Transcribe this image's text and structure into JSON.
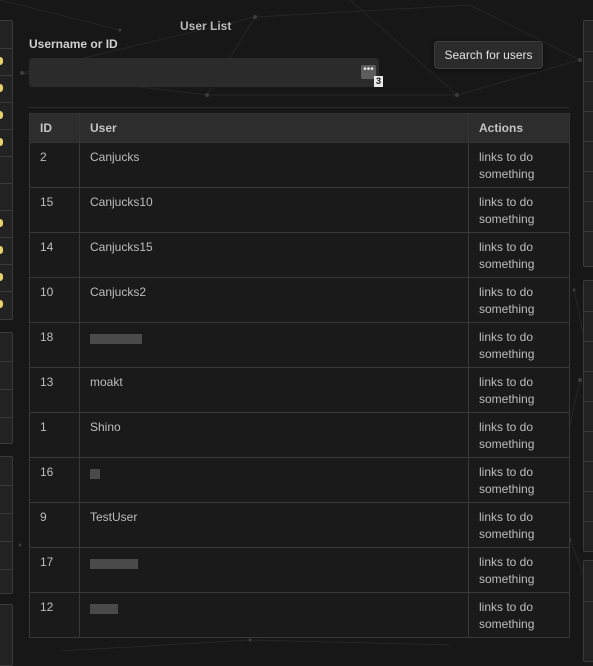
{
  "header": {
    "title": "User List",
    "search_label": "Username or ID",
    "search_value": "",
    "search_placeholder": "",
    "input_tool_glyph": "•••",
    "input_badge": "3",
    "search_button_label": "Search for users"
  },
  "table": {
    "columns": [
      "ID",
      "User",
      "Actions"
    ],
    "rows": [
      {
        "id": "2",
        "user": "Canjucks",
        "redacted": false,
        "actions": "links to do something"
      },
      {
        "id": "15",
        "user": "Canjucks10",
        "redacted": false,
        "actions": "links to do something"
      },
      {
        "id": "14",
        "user": "Canjucks15",
        "redacted": false,
        "actions": "links to do something"
      },
      {
        "id": "10",
        "user": "Canjucks2",
        "redacted": false,
        "actions": "links to do something"
      },
      {
        "id": "18",
        "user": "",
        "redacted": true,
        "actions": "links to do something"
      },
      {
        "id": "13",
        "user": "moakt",
        "redacted": false,
        "actions": "links to do something"
      },
      {
        "id": "1",
        "user": "Shino",
        "redacted": false,
        "actions": "links to do something"
      },
      {
        "id": "16",
        "user": "",
        "redacted": true,
        "actions": "links to do something"
      },
      {
        "id": "9",
        "user": "TestUser",
        "redacted": false,
        "actions": "links to do something"
      },
      {
        "id": "17",
        "user": "",
        "redacted": true,
        "actions": "links to do something"
      },
      {
        "id": "12",
        "user": "",
        "redacted": true,
        "actions": "links to do something"
      }
    ]
  },
  "colors": {
    "background": "#171717",
    "table_header": "#2d2d2d",
    "table_row": "#1a1a1a",
    "accent_dot": "#e8d16a"
  }
}
